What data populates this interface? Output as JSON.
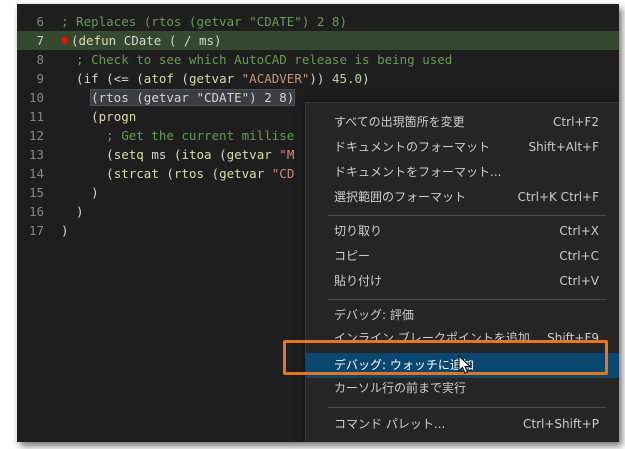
{
  "editor": {
    "lines": [
      {
        "num": "6",
        "segments": [
          {
            "t": "; Replaces (rtos (getvar \"CDATE\") 2 8)",
            "c": "c-com"
          }
        ]
      },
      {
        "num": "7",
        "segments": [
          {
            "t": "(",
            "c": ""
          },
          {
            "t": "defun",
            "c": "c-fn"
          },
          {
            "t": " CDate ( / ms)",
            "c": ""
          }
        ],
        "active": true,
        "breakpoint": true
      },
      {
        "num": "8",
        "segments": [
          {
            "t": "  ; Check to see which AutoCAD release is being used",
            "c": "c-com"
          }
        ]
      },
      {
        "num": "9",
        "segments": [
          {
            "t": "  (if (<= (",
            "c": ""
          },
          {
            "t": "atof",
            "c": "c-fn"
          },
          {
            "t": " (",
            "c": ""
          },
          {
            "t": "getvar",
            "c": "c-fn"
          },
          {
            "t": " ",
            "c": ""
          },
          {
            "t": "\"ACADVER\"",
            "c": "c-str"
          },
          {
            "t": ")) ",
            "c": ""
          },
          {
            "t": "45.0",
            "c": "c-num"
          },
          {
            "t": ")",
            "c": ""
          }
        ]
      },
      {
        "num": "10",
        "segments": [
          {
            "t": "    ",
            "c": ""
          },
          {
            "t": "(rtos (getvar \"CDATE\") 2 8)",
            "c": "hl"
          }
        ]
      },
      {
        "num": "11",
        "segments": [
          {
            "t": "    (",
            "c": ""
          },
          {
            "t": "progn",
            "c": "c-fn"
          }
        ]
      },
      {
        "num": "12",
        "segments": [
          {
            "t": "      ; Get the current millise",
            "c": "c-com"
          }
        ]
      },
      {
        "num": "13",
        "segments": [
          {
            "t": "      (",
            "c": ""
          },
          {
            "t": "setq",
            "c": "c-fn"
          },
          {
            "t": " ms (",
            "c": ""
          },
          {
            "t": "itoa",
            "c": "c-fn"
          },
          {
            "t": " (",
            "c": ""
          },
          {
            "t": "getvar",
            "c": "c-fn"
          },
          {
            "t": " ",
            "c": ""
          },
          {
            "t": "\"M",
            "c": "c-str"
          }
        ]
      },
      {
        "num": "14",
        "segments": [
          {
            "t": "      (",
            "c": ""
          },
          {
            "t": "strcat",
            "c": "c-fn"
          },
          {
            "t": " (",
            "c": ""
          },
          {
            "t": "rtos",
            "c": "c-fn"
          },
          {
            "t": " (",
            "c": ""
          },
          {
            "t": "getvar",
            "c": "c-fn"
          },
          {
            "t": " ",
            "c": ""
          },
          {
            "t": "\"CD",
            "c": "c-str"
          }
        ]
      },
      {
        "num": "15",
        "segments": [
          {
            "t": "    )",
            "c": ""
          }
        ]
      },
      {
        "num": "16",
        "segments": [
          {
            "t": "  )",
            "c": ""
          }
        ]
      },
      {
        "num": "17",
        "segments": [
          {
            "t": ")",
            "c": ""
          }
        ]
      }
    ]
  },
  "menu": {
    "items": [
      {
        "label": "すべての出現箇所を変更",
        "key": "Ctrl+F2"
      },
      {
        "label": "ドキュメントのフォーマット",
        "key": "Shift+Alt+F"
      },
      {
        "label": "ドキュメントをフォーマット...",
        "key": ""
      },
      {
        "label": "選択範囲のフォーマット",
        "key": "Ctrl+K Ctrl+F"
      },
      {
        "label": "切り取り",
        "key": "Ctrl+X"
      },
      {
        "label": "コピー",
        "key": "Ctrl+C"
      },
      {
        "label": "貼り付け",
        "key": "Ctrl+V"
      },
      {
        "label": "デバッグ: 評価",
        "key": ""
      },
      {
        "label": "インライン ブレークポイントを追加",
        "key": "Shift+F9"
      },
      {
        "label": "デバッグ: ウォッチに追加",
        "key": "",
        "selected": true
      },
      {
        "label": "カーソル行の前まで実行",
        "key": ""
      },
      {
        "label": "コマンド パレット...",
        "key": "Ctrl+Shift+P"
      }
    ]
  },
  "colors": {
    "selection": "#094771",
    "highlight_box": "#e8751a",
    "breakpoint": "#e51400"
  }
}
